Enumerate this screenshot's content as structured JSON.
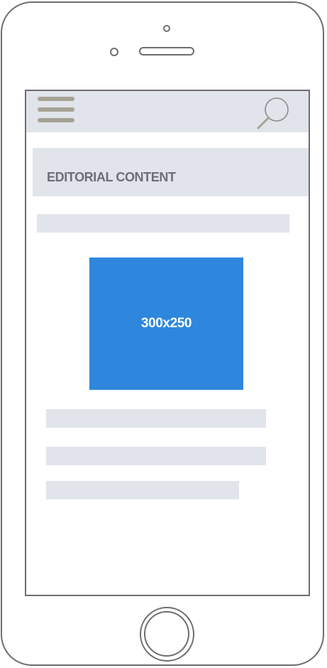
{
  "header": {
    "menu_icon": "hamburger-menu-icon",
    "search_icon": "search-icon"
  },
  "content": {
    "editorial_label": "EDITORIAL CONTENT",
    "ad_size_label": "300x250"
  },
  "colors": {
    "placeholder_gray": "#e2e4ec",
    "ad_blue": "#2e87dd",
    "outline": "#6e6e6e",
    "menu_lines": "#a5a295",
    "label_text": "#6c6e78"
  }
}
